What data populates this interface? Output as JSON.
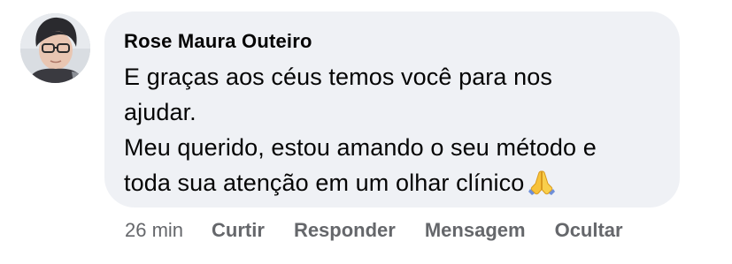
{
  "comment": {
    "author": "Rose Maura Outeiro",
    "avatar_icon": "profile-photo",
    "lines": [
      "E graças aos céus temos você para nos",
      "ajudar.",
      "Meu querido, estou amando o seu método e",
      "toda sua atenção em um olhar clínico"
    ],
    "emoji_icon": "folded-hands-emoji",
    "bubble_color": "#eff1f5",
    "time": "26 min",
    "actions": {
      "like": "Curtir",
      "reply": "Responder",
      "message": "Mensagem",
      "hide": "Ocultar"
    },
    "meta_color": "#65676b"
  }
}
